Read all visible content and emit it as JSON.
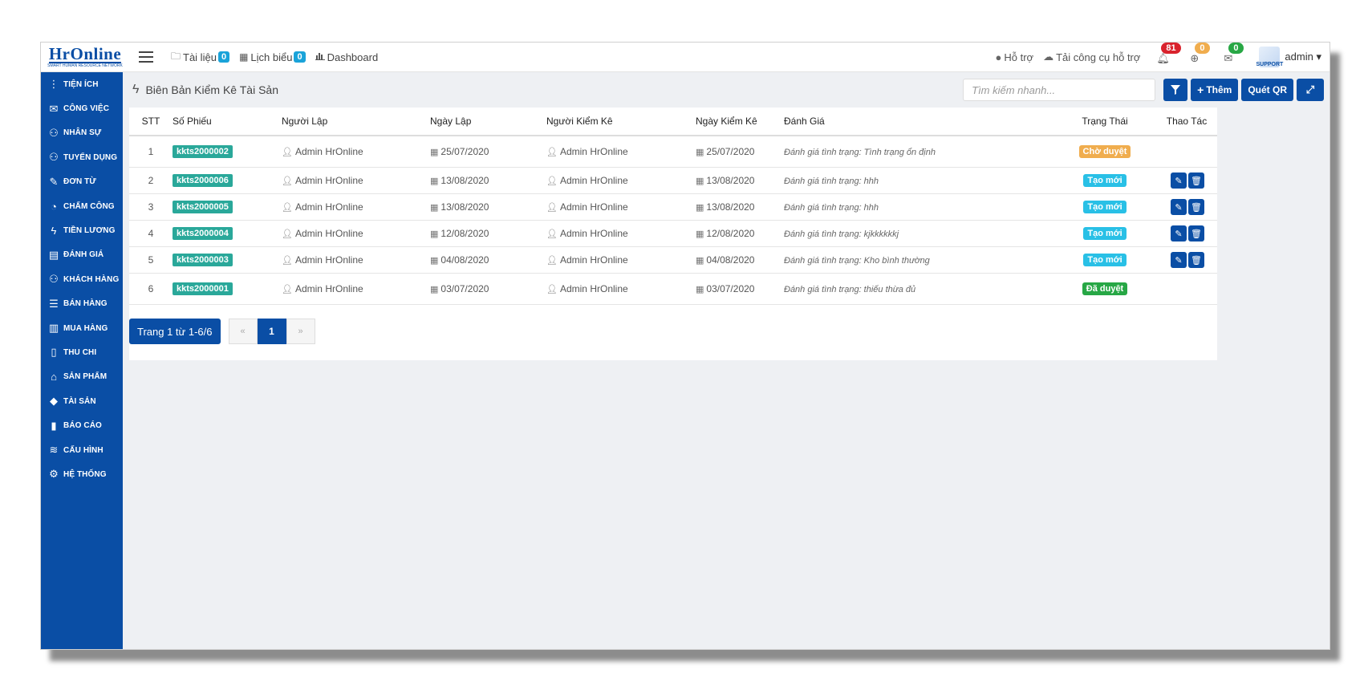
{
  "logo": {
    "name": "HrOnline",
    "tagline": "SMART HUMAN RESOURCE NETWORK"
  },
  "topnav": [
    {
      "label": "Tài liệu",
      "badge": "0",
      "icon": "folder-icon"
    },
    {
      "label": "Lịch biểu",
      "badge": "0",
      "icon": "calendar-icon"
    },
    {
      "label": "Dashboard",
      "badge": "",
      "icon": "bar-chart-icon"
    }
  ],
  "topright": {
    "support": "Hỗ trợ",
    "download": "Tải công cụ hỗ trợ",
    "notif_bell": "81",
    "notif_globe": "0",
    "notif_mail": "0",
    "avatar_text": "SUPPORT",
    "user": "admin"
  },
  "sidebar": [
    {
      "label": "TIỆN ÍCH",
      "icon": "vertical-dots-icon"
    },
    {
      "label": "CÔNG VIỆC",
      "icon": "inbox-icon"
    },
    {
      "label": "NHÂN SỰ",
      "icon": "user-icon"
    },
    {
      "label": "TUYỂN DỤNG",
      "icon": "user-add-icon"
    },
    {
      "label": "ĐƠN TỪ",
      "icon": "edit-icon"
    },
    {
      "label": "CHẤM CÔNG",
      "icon": "clock-gauge-icon"
    },
    {
      "label": "TIỀN LƯƠNG",
      "icon": "lightning-icon"
    },
    {
      "label": "ĐÁNH GIÁ",
      "icon": "book-icon"
    },
    {
      "label": "KHÁCH HÀNG",
      "icon": "customer-icon"
    },
    {
      "label": "BÁN HÀNG",
      "icon": "list-icon"
    },
    {
      "label": "MUA HÀNG",
      "icon": "columns-icon"
    },
    {
      "label": "THU CHI",
      "icon": "file-icon"
    },
    {
      "label": "SẢN PHẨM",
      "icon": "tag-icon"
    },
    {
      "label": "TÀI SẢN",
      "icon": "diamond-icon"
    },
    {
      "label": "BÁO CÁO",
      "icon": "bar-chart-icon"
    },
    {
      "label": "CẤU HÌNH",
      "icon": "layers-icon"
    },
    {
      "label": "HỆ THỐNG",
      "icon": "gear-icon"
    }
  ],
  "page": {
    "title": "Biên Bản Kiểm Kê Tài Sản",
    "search_placeholder": "Tìm kiếm nhanh...",
    "add_label": "Thêm",
    "scan_label": "Quét QR"
  },
  "table": {
    "headers": [
      "STT",
      "Số Phiếu",
      "Người Lập",
      "Ngày Lập",
      "Người Kiểm Kê",
      "Ngày Kiểm Kê",
      "Đánh Giá",
      "Trạng Thái",
      "Thao Tác"
    ],
    "rows": [
      {
        "stt": "1",
        "code": "kkts2000002",
        "creator": "Admin HrOnline",
        "created": "25/07/2020",
        "checker": "Admin HrOnline",
        "checked": "25/07/2020",
        "eval": "Đánh giá tình trạng: Tình trạng ổn định",
        "status": "Chờ duyệt",
        "status_color": "#f0ad4e",
        "actions": false
      },
      {
        "stt": "2",
        "code": "kkts2000006",
        "creator": "Admin HrOnline",
        "created": "13/08/2020",
        "checker": "Admin HrOnline",
        "checked": "13/08/2020",
        "eval": "Đánh giá tình trạng: hhh",
        "status": "Tạo mới",
        "status_color": "#29c0e6",
        "actions": true
      },
      {
        "stt": "3",
        "code": "kkts2000005",
        "creator": "Admin HrOnline",
        "created": "13/08/2020",
        "checker": "Admin HrOnline",
        "checked": "13/08/2020",
        "eval": "Đánh giá tình trạng: hhh",
        "status": "Tạo mới",
        "status_color": "#29c0e6",
        "actions": true
      },
      {
        "stt": "4",
        "code": "kkts2000004",
        "creator": "Admin HrOnline",
        "created": "12/08/2020",
        "checker": "Admin HrOnline",
        "checked": "12/08/2020",
        "eval": "Đánh giá tình trạng: kjkkkkkkj",
        "status": "Tạo mới",
        "status_color": "#29c0e6",
        "actions": true
      },
      {
        "stt": "5",
        "code": "kkts2000003",
        "creator": "Admin HrOnline",
        "created": "04/08/2020",
        "checker": "Admin HrOnline",
        "checked": "04/08/2020",
        "eval": "Đánh giá tình trạng: Kho bình thường",
        "status": "Tạo mới",
        "status_color": "#29c0e6",
        "actions": true
      },
      {
        "stt": "6",
        "code": "kkts2000001",
        "creator": "Admin HrOnline",
        "created": "03/07/2020",
        "checker": "Admin HrOnline",
        "checked": "03/07/2020",
        "eval": "Đánh giá tình trạng: thiếu thừa đủ",
        "status": "Đã duyệt",
        "status_color": "#27a745",
        "actions": false
      }
    ]
  },
  "pagination": {
    "info": "Trang 1 từ 1-6/6",
    "prev": "«",
    "current": "1",
    "next": "»"
  },
  "colors": {
    "primary": "#0a4ea5",
    "code_badge": "#2aa89a",
    "bell_badge": "#d9232d",
    "globe_badge": "#f0ad4e",
    "mail_badge": "#28a745"
  }
}
